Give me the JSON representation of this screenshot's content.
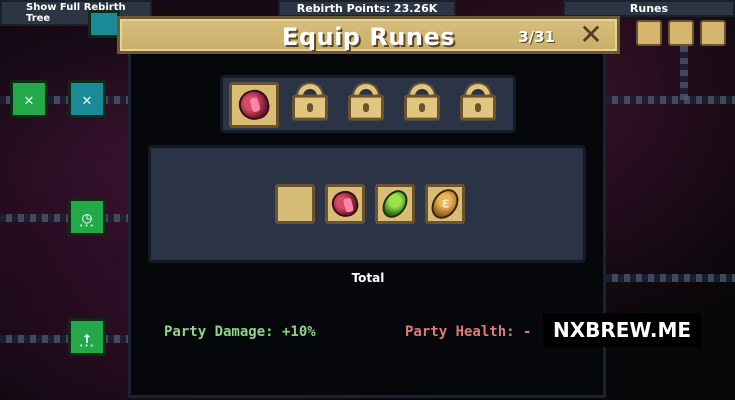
{
  "top_bar": {
    "rebirth_tree_label": "Show Full Rebirth Tree",
    "rebirth_points_label": "Rebirth Points: 23.26K",
    "runes_label": "Runes"
  },
  "dialog": {
    "title": "Equip Runes",
    "count": "3/31",
    "close_glyph": "✕",
    "equip_slots": [
      {
        "state": "equipped",
        "rune": "red-rune"
      },
      {
        "state": "locked"
      },
      {
        "state": "locked"
      },
      {
        "state": "locked"
      },
      {
        "state": "locked"
      }
    ],
    "inventory": [
      {
        "rune": "empty"
      },
      {
        "rune": "red-rune"
      },
      {
        "rune": "green-rune"
      },
      {
        "rune": "gold-rune"
      }
    ],
    "total_label": "Total",
    "party_damage": "Party Damage: +10%",
    "party_health": "Party Health: -"
  },
  "watermark": "NXBREW.ME"
}
